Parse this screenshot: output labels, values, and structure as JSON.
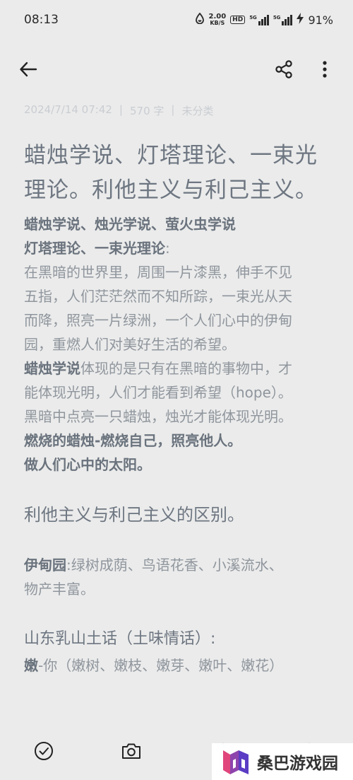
{
  "status_bar": {
    "time": "08:13",
    "net_speed_value": "2.00",
    "net_speed_unit": "KB/S",
    "hd_badge": "HD",
    "sim1_label": "5G",
    "sim2_label": "5G",
    "battery": "91%"
  },
  "toolbar": {
    "back_icon": "arrow-left-icon",
    "share_icon": "share-icon",
    "more_icon": "more-vertical-icon"
  },
  "meta": {
    "datetime": "2024/7/14 07:42",
    "sep1": "|",
    "word_count": "570 字",
    "sep2": "|",
    "category": "未分类"
  },
  "note": {
    "title_line1": "蜡烛学说、灯塔理论、一束光",
    "title_line2": "理论。利他主义与利己主义。",
    "subhead_line1": "蜡烛学说、烛光学说、萤火虫学说",
    "subhead_line2": "灯塔理论、一束光理论",
    "subhead_line2_tail": ":",
    "para1_lines": [
      "在黑暗的世界里，周围一片漆黑，伸手不见",
      "五指，人们茫茫然而不知所踪，一束光从天",
      "而降，照亮一片绿洲，一个人们心中的伊甸",
      "园，重燃人们对美好生活的希望。"
    ],
    "para2_bold": "蜡烛学说",
    "para2_line1_tail": "体现的是只有在黑暗的事物中，才",
    "para2_lines": [
      "能体现光明，人们才能看到希望（hope）。",
      "黑暗中点亮一只蜡烛，烛光才能体现光明。"
    ],
    "bold_line1": "燃烧的蜡烛-燃烧自己，照亮他人。",
    "bold_line2": "做人们心中的太阳。",
    "heading2": "利他主义与利己主义的区别。",
    "eden_bold": "伊甸园",
    "eden_line1_tail": ":绿树成荫、鸟语花香、小溪流水、",
    "eden_line2": "物产丰富。",
    "heading3": "山东乳山土话（土味情话）:",
    "last_bold": "嫩",
    "last_tail": "-你（嫩树、嫩枝、嫩芽、嫩叶、嫩花）"
  },
  "bottom_bar": {
    "check_icon": "check-circle-icon",
    "camera_icon": "camera-icon"
  },
  "watermark": {
    "text": "桑巴游戏园"
  }
}
